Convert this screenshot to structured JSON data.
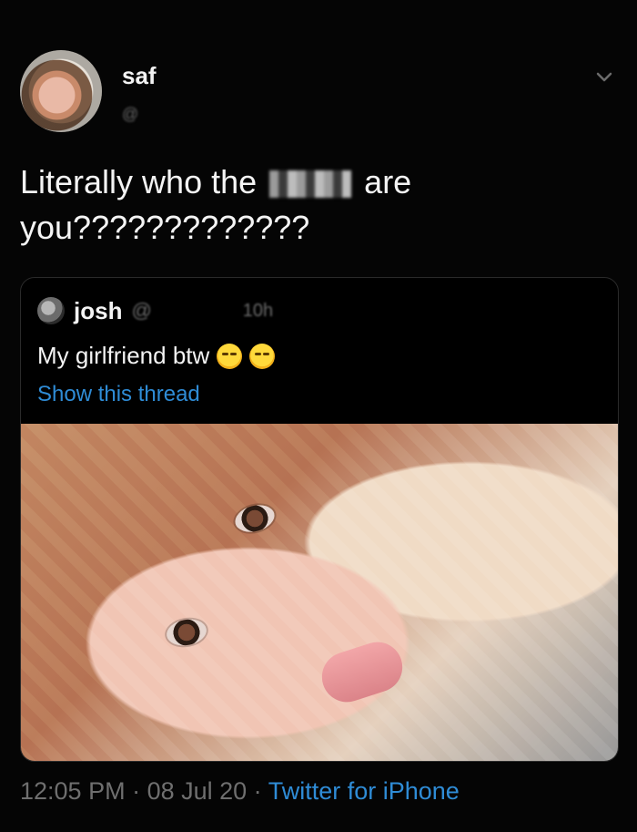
{
  "tweet": {
    "author": {
      "name": "saf",
      "handle_redacted": "@"
    },
    "text_line1_before": "Literally who the",
    "text_line1_after": "are",
    "text_line2": "you?????????????",
    "quote": {
      "author": {
        "name": "josh",
        "handle_redacted": "@",
        "time_redacted": "10h"
      },
      "text": "My girlfriend btw",
      "emojis": [
        "relieved-face-icon",
        "relieved-face-icon"
      ],
      "show_thread_label": "Show this thread"
    },
    "meta": {
      "time": "12:05 PM",
      "sep1": " · ",
      "date": "08 Jul 20",
      "sep2": " · ",
      "source": "Twitter for iPhone"
    }
  },
  "colors": {
    "background": "#050505",
    "link": "#2f8cd6",
    "muted": "#6f6f6f"
  }
}
